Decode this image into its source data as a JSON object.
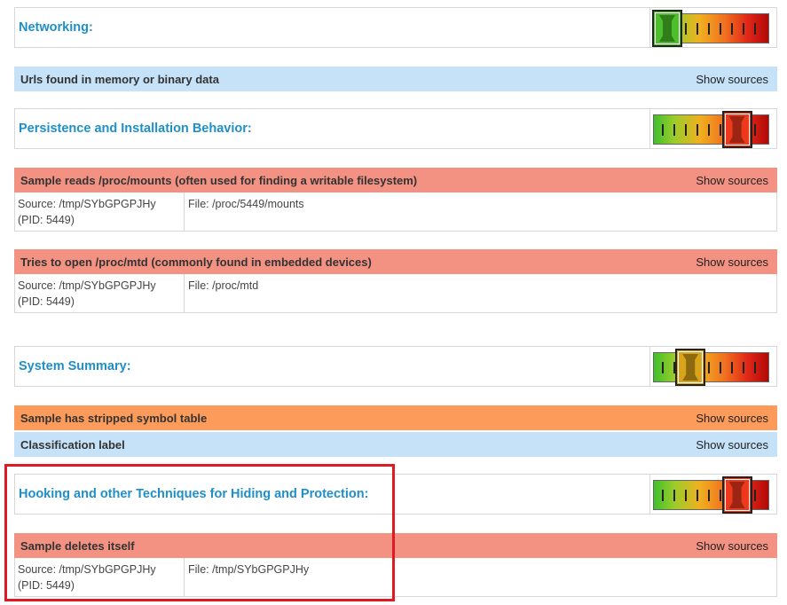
{
  "show_sources_label": "Show sources",
  "colors": {
    "title_blue": "#1f8fc8",
    "bar_red": "#f39282",
    "bar_orange": "#fc9b5a",
    "bar_blue": "#c6e2f9",
    "highlight": "#e01a22"
  },
  "sections": [
    {
      "title": "Networking:",
      "gauge_level": 1,
      "gauge_max": 5,
      "indicator_color": "#4cc02a",
      "items": [
        {
          "label": "Urls found in memory or binary data",
          "severity": "info"
        }
      ]
    },
    {
      "title": "Persistence and Installation Behavior:",
      "gauge_level": 4,
      "gauge_max": 5,
      "indicator_color": "#ee3a1c",
      "items": [
        {
          "label": "Sample reads /proc/mounts (often used for finding a writable filesystem)",
          "severity": "malicious",
          "source_line1": "Source: /tmp/SYbGPGPJHy",
          "source_line2": "(PID: 5449)",
          "file": "File: /proc/5449/mounts"
        },
        {
          "label": "Tries to open /proc/mtd (commonly found in embedded devices)",
          "severity": "malicious",
          "source_line1": "Source: /tmp/SYbGPGPJHy",
          "source_line2": "(PID: 5449)",
          "file": "File: /proc/mtd"
        }
      ]
    },
    {
      "title": "System Summary:",
      "gauge_level": 2,
      "gauge_max": 5,
      "indicator_color": "#d9a41a",
      "items": [
        {
          "label": "Sample has stripped symbol table",
          "severity": "suspicious"
        },
        {
          "label": "Classification label",
          "severity": "info"
        }
      ]
    },
    {
      "title": "Hooking and other Techniques for Hiding and Protection:",
      "gauge_level": 4,
      "gauge_max": 5,
      "indicator_color": "#ee3a1c",
      "items": [
        {
          "label": "Sample deletes itself",
          "severity": "malicious",
          "source_line1": "Source: /tmp/SYbGPGPJHy",
          "source_line2": "(PID: 5449)",
          "file": "File: /tmp/SYbGPGPJHy"
        }
      ]
    }
  ]
}
